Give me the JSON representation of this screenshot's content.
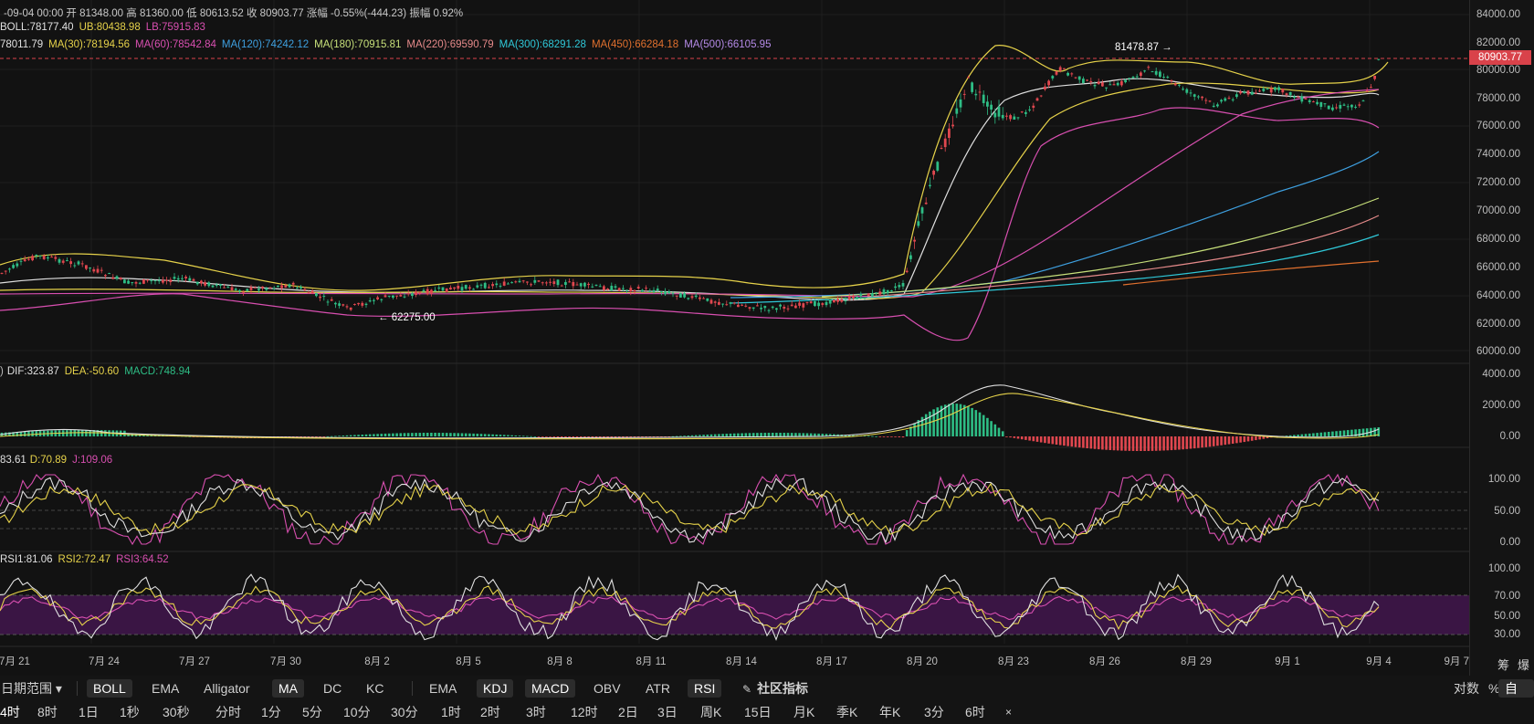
{
  "header": {
    "line1": "-09-04 00:00  开 81348.00  高 81360.00  低 80613.52  收 80903.77  涨幅 -0.55%(-444.23)  振幅 0.92%",
    "boll": "BOLL:78177.40",
    "ub": "UB:80438.98",
    "lb": "LB:75915.83"
  },
  "ma_legend": [
    {
      "label": "78011.79",
      "color": "#e0e0e0"
    },
    {
      "label": "MA(30):78194.56",
      "color": "#e6d24a"
    },
    {
      "label": "MA(60):78542.84",
      "color": "#d84fb0"
    },
    {
      "label": "MA(120):74242.12",
      "color": "#3ea0e0"
    },
    {
      "label": "MA(180):70915.81",
      "color": "#c7e07a"
    },
    {
      "label": "MA(220):69590.79",
      "color": "#e58a8a"
    },
    {
      "label": "MA(300):68291.28",
      "color": "#2fc8d8"
    },
    {
      "label": "MA(450):66284.18",
      "color": "#e0702e"
    },
    {
      "label": "MA(500):66105.95",
      "color": "#b48ae6"
    }
  ],
  "price_axis": [
    "84000.00",
    "82000.00",
    "80000.00",
    "78000.00",
    "76000.00",
    "74000.00",
    "72000.00",
    "70000.00",
    "68000.00",
    "66000.00",
    "64000.00",
    "62000.00",
    "60000.00"
  ],
  "current_price": "80903.77",
  "annotations": {
    "high": "81478.87 →",
    "low": "← 62275.00"
  },
  "macd": {
    "dif": "DIF:323.87",
    "dea": "DEA:-50.60",
    "macd": "MACD:748.94",
    "prefix": ")"
  },
  "macd_axis": [
    "4000.00",
    "2000.00",
    "0.00"
  ],
  "kdj": {
    "k": "83.61",
    "d": "D:70.89",
    "j": "J:109.06"
  },
  "kdj_axis": [
    "100.00",
    "50.00",
    "0.00"
  ],
  "rsi": {
    "r1": "RSI1:81.06",
    "r2": "RSI2:72.47",
    "r3": "RSI3:64.52"
  },
  "rsi_axis": [
    "100.00",
    "70.00",
    "50.00",
    "30.00"
  ],
  "x_axis": [
    "7月 21",
    "7月 24",
    "7月 27",
    "7月 30",
    "8月 2",
    "8月 5",
    "8月 8",
    "8月 11",
    "8月 14",
    "8月 17",
    "8月 20",
    "8月 23",
    "8月 26",
    "8月 29",
    "9月 1",
    "9月 4",
    "9月 7"
  ],
  "side": {
    "chip": "筹",
    "burst": "爆"
  },
  "toolbar1": {
    "range": "日期范围",
    "main_indicators": [
      "BOLL",
      "EMA",
      "Alligator",
      "MA",
      "DC",
      "KC"
    ],
    "sub_indicators": [
      "EMA",
      "KDJ",
      "MACD",
      "OBV",
      "ATR",
      "RSI"
    ],
    "community": "社区指标",
    "log": "对数",
    "pct": "%",
    "auto": "自动"
  },
  "toolbar2": {
    "intervals": [
      "4时",
      "8时",
      "1日",
      "1秒",
      "30秒",
      "分时",
      "1分",
      "5分",
      "10分",
      "30分",
      "1时",
      "2时",
      "3时",
      "12时",
      "2日",
      "3日",
      "周K",
      "15日",
      "月K",
      "季K",
      "年K",
      "3分",
      "6时"
    ],
    "close": "×"
  },
  "colors": {
    "up": "#2ebd85",
    "down": "#e0474f",
    "bg": "#121212",
    "rsi_band": "#3a1544"
  }
}
